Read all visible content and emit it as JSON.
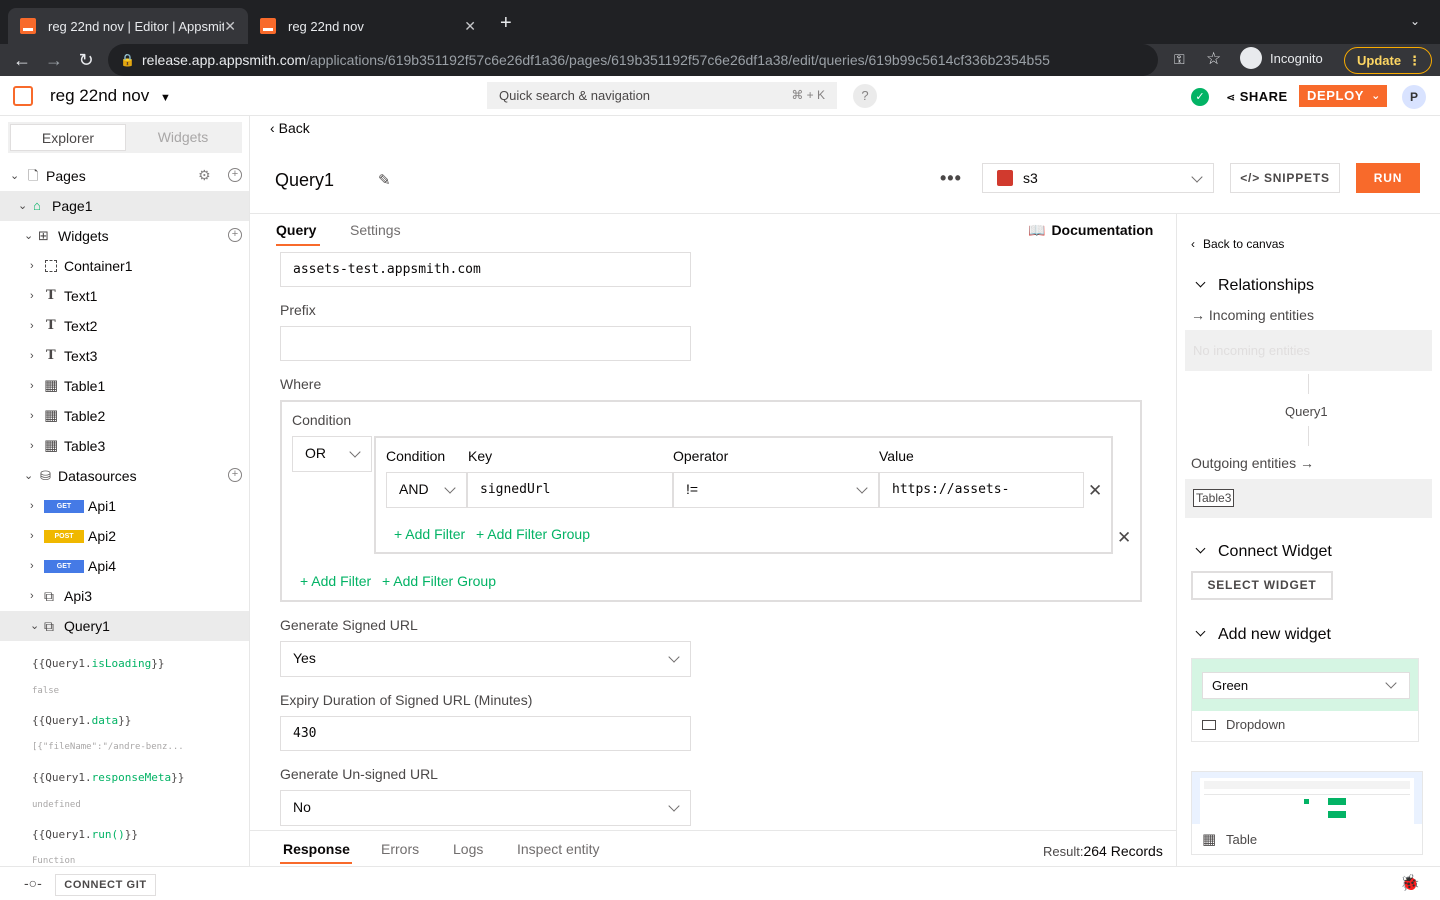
{
  "browser": {
    "tabs": [
      {
        "title": "reg 22nd nov | Editor | Appsmith"
      },
      {
        "title": "reg 22nd nov"
      }
    ],
    "new_tab": "+",
    "url_host": "release.app.appsmith.com",
    "url_path": "/applications/619b351192f57c6e26df1a36/pages/619b351192f57c6e26df1a38/edit/queries/619b99c5614cf336b2354b55",
    "incognito_label": "Incognito",
    "update_label": "Update"
  },
  "header": {
    "app_name": "reg 22nd nov",
    "search_placeholder": "Quick search & navigation",
    "search_shortcut": "⌘ + K",
    "help": "?",
    "share_label": "SHARE",
    "deploy_label": "DEPLOY",
    "avatar_initial": "P"
  },
  "sidebar": {
    "tabs": {
      "explorer": "Explorer",
      "widgets": "Widgets"
    },
    "pages_label": "Pages",
    "page1": "Page1",
    "widgets_label": "Widgets",
    "widgets": [
      {
        "label": "Container1",
        "icon": "container-icon"
      },
      {
        "label": "Text1",
        "icon": "text-icon"
      },
      {
        "label": "Text2",
        "icon": "text-icon"
      },
      {
        "label": "Text3",
        "icon": "text-icon"
      },
      {
        "label": "Table1",
        "icon": "table-icon"
      },
      {
        "label": "Table2",
        "icon": "table-icon"
      },
      {
        "label": "Table3",
        "icon": "table-icon"
      }
    ],
    "datasources_label": "Datasources",
    "apis": [
      {
        "label": "Api1",
        "method": "GET",
        "color": "#457ae6"
      },
      {
        "label": "Api2",
        "method": "POST",
        "color": "#f0b800"
      },
      {
        "label": "Api4",
        "method": "GET",
        "color": "#457ae6"
      }
    ],
    "api3": "Api3",
    "query1": "Query1",
    "bindings": [
      {
        "prefix": "{{Query1.",
        "prop": "isLoading",
        "suffix": "}}",
        "value": "false"
      },
      {
        "prefix": "{{Query1.",
        "prop": "data",
        "suffix": "}}",
        "value": "[{\"fileName\":\"/andre-benz..."
      },
      {
        "prefix": "{{Query1.",
        "prop": "responseMeta",
        "suffix": "}}",
        "value": "undefined"
      },
      {
        "prefix": "{{Query1.",
        "prop": "run()",
        "suffix": "}}",
        "value": "Function"
      }
    ]
  },
  "footer": {
    "connect_git": "CONNECT GIT"
  },
  "editor": {
    "back": "Back",
    "query_name": "Query1",
    "more": "•••",
    "datasource": "s3",
    "snippets": "SNIPPETS",
    "run": "RUN",
    "tabs": {
      "query": "Query",
      "settings": "Settings"
    },
    "documentation": "Documentation",
    "bucket_value": "assets-test.appsmith.com",
    "prefix_label": "Prefix",
    "prefix_value": "",
    "where_label": "Where",
    "condition_label": "Condition",
    "outer_condition": "OR",
    "inner": {
      "condition_header": "Condition",
      "key_header": "Key",
      "operator_header": "Operator",
      "value_header": "Value",
      "condition": "AND",
      "key": "signedUrl",
      "operator": "!=",
      "value": "https://assets-"
    },
    "add_filter": "+ Add Filter",
    "add_filter_group": "+ Add Filter Group",
    "signed_url_label": "Generate Signed URL",
    "signed_url_value": "Yes",
    "expiry_label": "Expiry Duration of Signed URL (Minutes)",
    "expiry_value": "430",
    "unsigned_label": "Generate Un-signed URL",
    "unsigned_value": "No"
  },
  "response": {
    "tabs": [
      "Response",
      "Errors",
      "Logs",
      "Inspect entity"
    ],
    "result_label": "Result:",
    "result_value": "264 Records"
  },
  "rightpane": {
    "back_to_canvas": "Back to canvas",
    "relationships": "Relationships",
    "incoming": "Incoming entities",
    "no_incoming": "No incoming entities",
    "center_entity": "Query1",
    "outgoing": "Outgoing entities",
    "outgoing_item": "Table3",
    "connect_widget": "Connect Widget",
    "select_widget": "SELECT WIDGET",
    "add_new_widget": "Add new widget",
    "dropdown_preview_value": "Green",
    "dropdown_label": "Dropdown",
    "table_label": "Table"
  },
  "colors": {
    "accent": "#f86a2b",
    "success": "#03b365"
  }
}
